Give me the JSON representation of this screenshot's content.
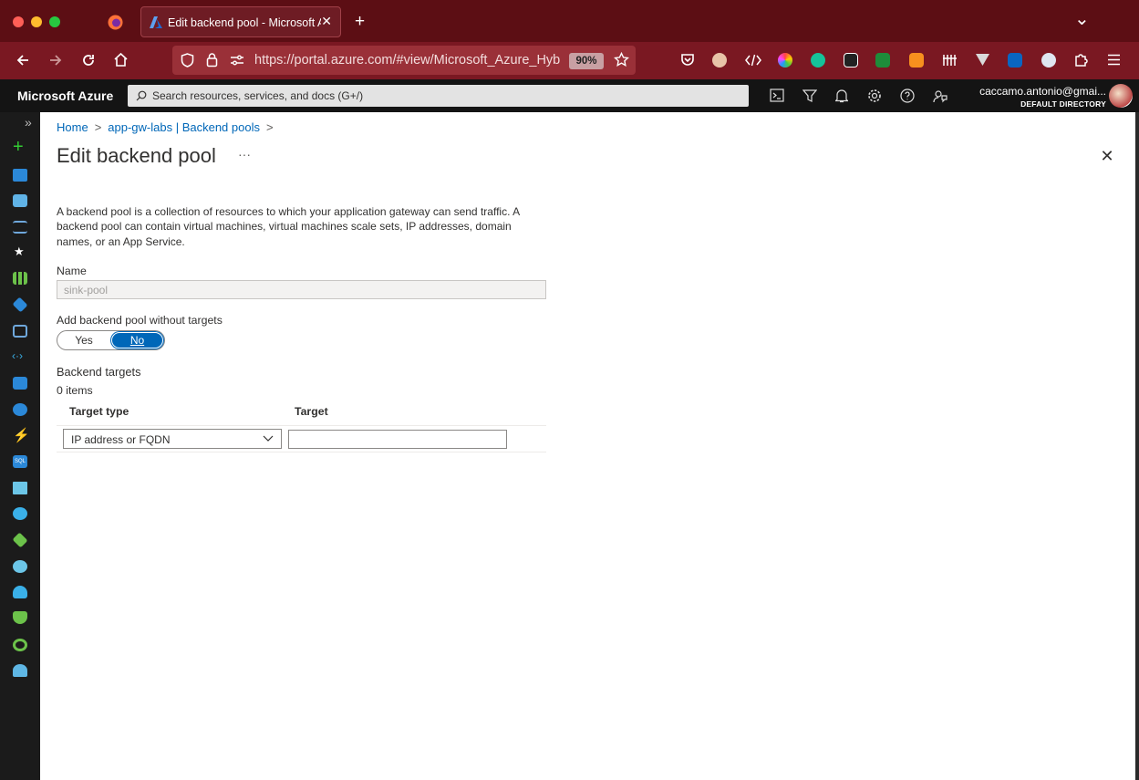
{
  "browser": {
    "tab_title": "Edit backend pool - Microsoft Azure",
    "url": "https://portal.azure.com/#view/Microsoft_Azure_Hyb",
    "zoom": "90%",
    "new_tab_glyph": "+",
    "chevron_glyph": "⌄"
  },
  "portal": {
    "brand": "Microsoft Azure",
    "search_placeholder": "Search resources, services, and docs (G+/)",
    "user_email": "caccamo.antonio@gmai...",
    "user_directory": "DEFAULT DIRECTORY",
    "sidebar_expand_glyph": "»"
  },
  "breadcrumb": {
    "home": "Home",
    "parent": "app-gw-labs | Backend pools",
    "sep": ">"
  },
  "page": {
    "title": "Edit backend pool",
    "more": "···",
    "close": "✕",
    "description": "A backend pool is a collection of resources to which your application gateway can send traffic. A backend pool can contain virtual machines, virtual machines scale sets, IP addresses, domain names, or an App Service."
  },
  "form": {
    "name_label": "Name",
    "name_value": "sink-pool",
    "without_targets_label": "Add backend pool without targets",
    "toggle_yes": "Yes",
    "toggle_no": "No",
    "toggle_selected": "No",
    "targets_label": "Backend targets",
    "items_count": "0 items",
    "col_target_type": "Target type",
    "col_target": "Target",
    "target_type_value": "IP address or FQDN",
    "target_value": ""
  },
  "colors": {
    "browser_chrome": "#5c0e14",
    "azure_header": "#141414",
    "accent": "#0067b8"
  },
  "icons": {
    "toolbar": [
      "back-icon",
      "forward-icon",
      "reload-icon",
      "home-icon"
    ],
    "header": [
      "cloud-shell-icon",
      "directory-filter-icon",
      "notifications-icon",
      "settings-icon",
      "help-icon",
      "feedback-icon"
    ]
  }
}
